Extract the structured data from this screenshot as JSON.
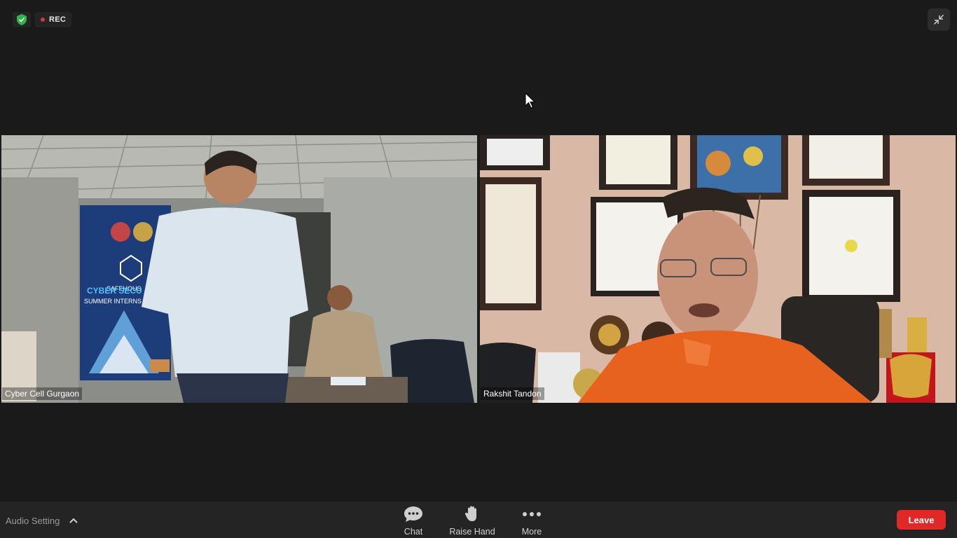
{
  "status": {
    "rec_label": "REC"
  },
  "participants": [
    {
      "name": "Cyber Cell Gurgaon"
    },
    {
      "name": "Rakshit Tandon"
    }
  ],
  "video_content": {
    "banner_text": "CYBER SECU",
    "banner_subtext": "SUMMER INTERNS",
    "banner_logo": "SAFEHOUS"
  },
  "footer": {
    "audio_setting_label": "Audio Setting",
    "chat_label": "Chat",
    "raise_hand_label": "Raise Hand",
    "more_label": "More",
    "leave_label": "Leave"
  },
  "colors": {
    "background": "#1a1a1a",
    "footer": "#242424",
    "leave": "#e02828",
    "secure_green": "#2fb34a",
    "rec_red": "#d23a3a"
  }
}
